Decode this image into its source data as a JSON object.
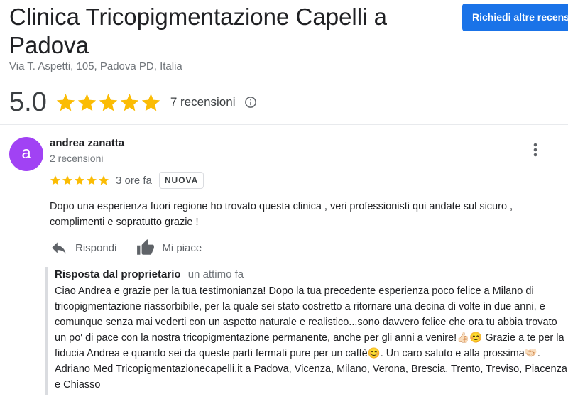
{
  "business": {
    "name": "Clinica Tricopigmentazione Capelli a Padova",
    "address": "Via T. Aspetti, 105, Padova PD, Italia",
    "rating": "5.0",
    "rating_stars": 5,
    "review_count_text": "7 recensioni"
  },
  "header": {
    "request_button_label": "Richiedi altre recensioni"
  },
  "icons": {
    "star": "star-icon",
    "info": "info-icon",
    "more": "more-vert-icon",
    "reply": "reply-arrow-icon",
    "like": "thumb-up-icon"
  },
  "colors": {
    "star": "#fbbc04",
    "accent_button": "#1a73e8",
    "avatar_bg": "#a142f4"
  },
  "review": {
    "avatar_letter": "a",
    "author": "andrea zanatta",
    "author_reviews": "2 recensioni",
    "stars": 5,
    "time": "3 ore fa",
    "badge": "NUOVA",
    "text": "Dopo una esperienza fuori regione ho trovato questa clinica , veri professionisti qui andate sul sicuro , complimenti e sopratutto grazie !",
    "reply_action": "Rispondi",
    "like_action": "Mi piace"
  },
  "owner_reply": {
    "label": "Risposta dal proprietario",
    "time": "un attimo fa",
    "text": "Ciao Andrea e grazie per la tua testimonianza! Dopo la tua precedente esperienza poco felice a Milano di tricopigmentazione riassorbibile, per la quale sei stato costretto a ritornare una decina di volte in due anni, e comunque senza mai vederti con un aspetto naturale e realistico...sono davvero felice che ora tu abbia trovato un po' di pace con la nostra tricopigmentazione permanente, anche per gli anni a venire!👍🏻😊 Grazie a te per la fiducia Andrea e quando sei da queste parti fermati pure per un caffè😊. Un caro saluto e alla prossima🤝🏻. Adriano Med Tricopigmentazionecapelli.it a Padova, Vicenza, Milano, Verona, Brescia, Trento, Treviso, Piacenza e Chiasso"
  }
}
